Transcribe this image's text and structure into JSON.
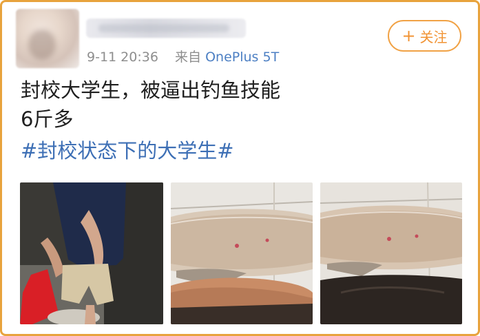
{
  "post": {
    "timestamp": "9-11 20:36",
    "source_prefix": "来自",
    "device": "OnePlus 5T",
    "text_line_1": "封校大学生，被逼出钓鱼技能",
    "text_line_2": "6斤多",
    "hashtag": "#封校状态下的大学生#"
  },
  "actions": {
    "follow_plus": "+",
    "follow_label": "关注"
  },
  "colors": {
    "frame": "#e8a33d",
    "follow": "#f19333",
    "link": "#3d6fb5",
    "meta": "#8e8e8e"
  },
  "photos": [
    {
      "name": "student-with-fish-photo"
    },
    {
      "name": "fish-on-floor-photo"
    },
    {
      "name": "fish-close-up-photo"
    }
  ]
}
